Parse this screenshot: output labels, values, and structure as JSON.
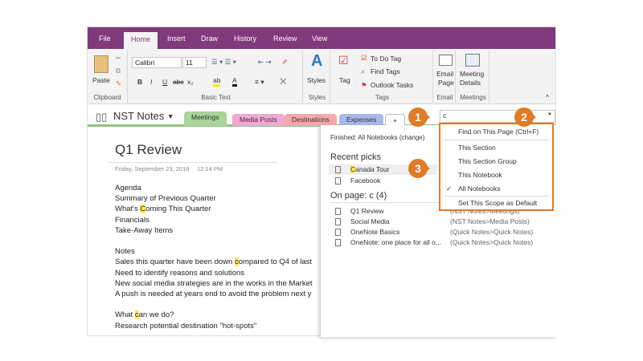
{
  "ribbon_tabs": [
    "File",
    "Home",
    "Insert",
    "Draw",
    "History",
    "Review",
    "View"
  ],
  "ribbon": {
    "paste": "Paste",
    "font": "Calibri",
    "size": "11",
    "styles": "Styles",
    "tag": "Tag",
    "todo": "To Do Tag",
    "find_tags": "Find Tags",
    "outlook": "Outlook Tasks",
    "email1": "Email",
    "email2": "Page",
    "meeting1": "Meeting",
    "meeting2": "Details",
    "groups": {
      "clipboard": "Clipboard",
      "basic_text": "Basic Text",
      "styles": "Styles",
      "tags": "Tags",
      "email": "Email",
      "meetings": "Meetings"
    },
    "bold": "B",
    "italic": "I",
    "underline": "U",
    "strike": "abc",
    "sub": "x₂"
  },
  "notebook": {
    "name": "NST Notes",
    "sections": [
      "Meetings",
      "Media Posts",
      "Destinations",
      "Expenses",
      "+"
    ],
    "colors": [
      "#a9d49a",
      "#f2a7d4",
      "#f4a9ab",
      "#a9b8ea",
      "#fff"
    ]
  },
  "search": {
    "query": "c"
  },
  "page": {
    "title": "Q1 Review",
    "date": "Friday, September 23, 2016",
    "time": "12:14 PM",
    "lines": [
      [
        "Agenda",
        "",
        ""
      ],
      [
        "Summary of Previous Quarter",
        "",
        ""
      ],
      [
        "What's ",
        "C",
        "oming This Quarter"
      ],
      [
        "Financials",
        "",
        ""
      ],
      [
        "Take-Away Items",
        "",
        ""
      ],
      [
        "",
        "",
        ""
      ],
      [
        "Notes",
        "",
        ""
      ],
      [
        "Sales this quarter have been down ",
        "c",
        "ompared to Q4 of last"
      ],
      [
        "Need to identify reasons and solutions",
        "",
        ""
      ],
      [
        "New social media strategies are in the works in the Market",
        "",
        ""
      ],
      [
        "A push is needed at years end to avoid the problem next y",
        "",
        ""
      ],
      [
        "",
        "",
        ""
      ],
      [
        "What ",
        "c",
        "an we do?"
      ],
      [
        "Research potential destination \"hot-spots\"",
        "",
        ""
      ]
    ]
  },
  "results": {
    "finished": "Finished:  All Notebooks (change)",
    "recent_heading": "Recent picks",
    "recent": [
      [
        "",
        "C",
        "anada Tour"
      ],
      [
        "Facebook",
        "",
        ""
      ]
    ],
    "onpage_heading": "On page:  c (4)",
    "onpage": [
      {
        "name": "Q1 Review",
        "loc": "(NST Notes>Meetings)"
      },
      {
        "name": "Social Media",
        "loc": "(NST Notes>Media Posts)"
      },
      {
        "name": "OneNote Basics",
        "loc": "(Quick Notes>Quick Notes)"
      },
      {
        "name": "OneNote: one place for all o...",
        "loc": "(Quick Notes>Quick Notes)"
      }
    ]
  },
  "scope_menu": {
    "find_page": "Find on This Page (Ctrl+F)",
    "items": [
      "This Section",
      "This Section Group",
      "This Notebook",
      "All Notebooks"
    ],
    "checked": "✓",
    "default": "Set This Scope as Default"
  },
  "badges": [
    "1",
    "2",
    "3"
  ]
}
